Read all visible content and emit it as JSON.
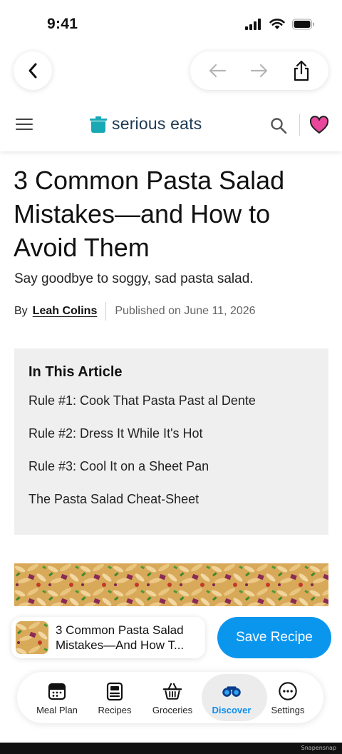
{
  "status_bar": {
    "time": "9:41"
  },
  "site": {
    "brand_name": "serious eats",
    "brand_color": "#1d3a54",
    "accent_color": "#0b96ee"
  },
  "article": {
    "title": "3 Common Pasta Salad Mistakes—and How to Avoid Them",
    "subtitle": "Say goodbye to soggy, sad pasta salad.",
    "by_label": "By",
    "author": "Leah Colins",
    "published": "Published on June 11, 2026"
  },
  "toc": {
    "title": "In This Article",
    "items": [
      "Rule #1: Cook That Pasta Past al Dente",
      "Rule #2: Dress It While It's Hot",
      "Rule #3: Cool It on a Sheet Pan",
      "The Pasta Salad Cheat-Sheet"
    ]
  },
  "save_bar": {
    "card_title_line1": "3 Common Pasta Salad",
    "card_title_line2": "Mistakes—And How T...",
    "save_label": "Save Recipe"
  },
  "tabs": [
    {
      "label": "Meal Plan",
      "icon": "calendar-icon"
    },
    {
      "label": "Recipes",
      "icon": "recipe-book-icon"
    },
    {
      "label": "Groceries",
      "icon": "basket-icon"
    },
    {
      "label": "Discover",
      "icon": "binoculars-icon",
      "active": true
    },
    {
      "label": "Settings",
      "icon": "more-icon"
    }
  ],
  "watermark": "Snapensnap"
}
